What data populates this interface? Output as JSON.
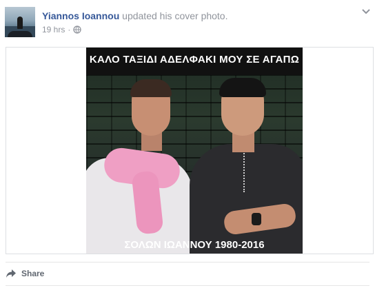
{
  "post": {
    "author": "Yiannos Ioannou",
    "action": "updated his cover photo.",
    "time": "19 hrs",
    "separator": "·",
    "privacy_icon": "globe-icon",
    "options_icon": "chevron-down-icon"
  },
  "photo": {
    "caption_top": "ΚΑΛΟ ΤΑΞΙΔΙ ΑΔΕΛΦΑΚΙ ΜΟΥ ΣΕ ΑΓΑΠΩ",
    "caption_bottom": "ΣΟΛΩΝ ΙΩΑΝΝΟΥ 1980-2016"
  },
  "actions": {
    "share_label": "Share",
    "share_icon": "share-arrow-icon"
  },
  "colors": {
    "author_link": "#365899",
    "muted_text": "#90949c",
    "action_text": "#606770",
    "border": "#dddfe2"
  }
}
